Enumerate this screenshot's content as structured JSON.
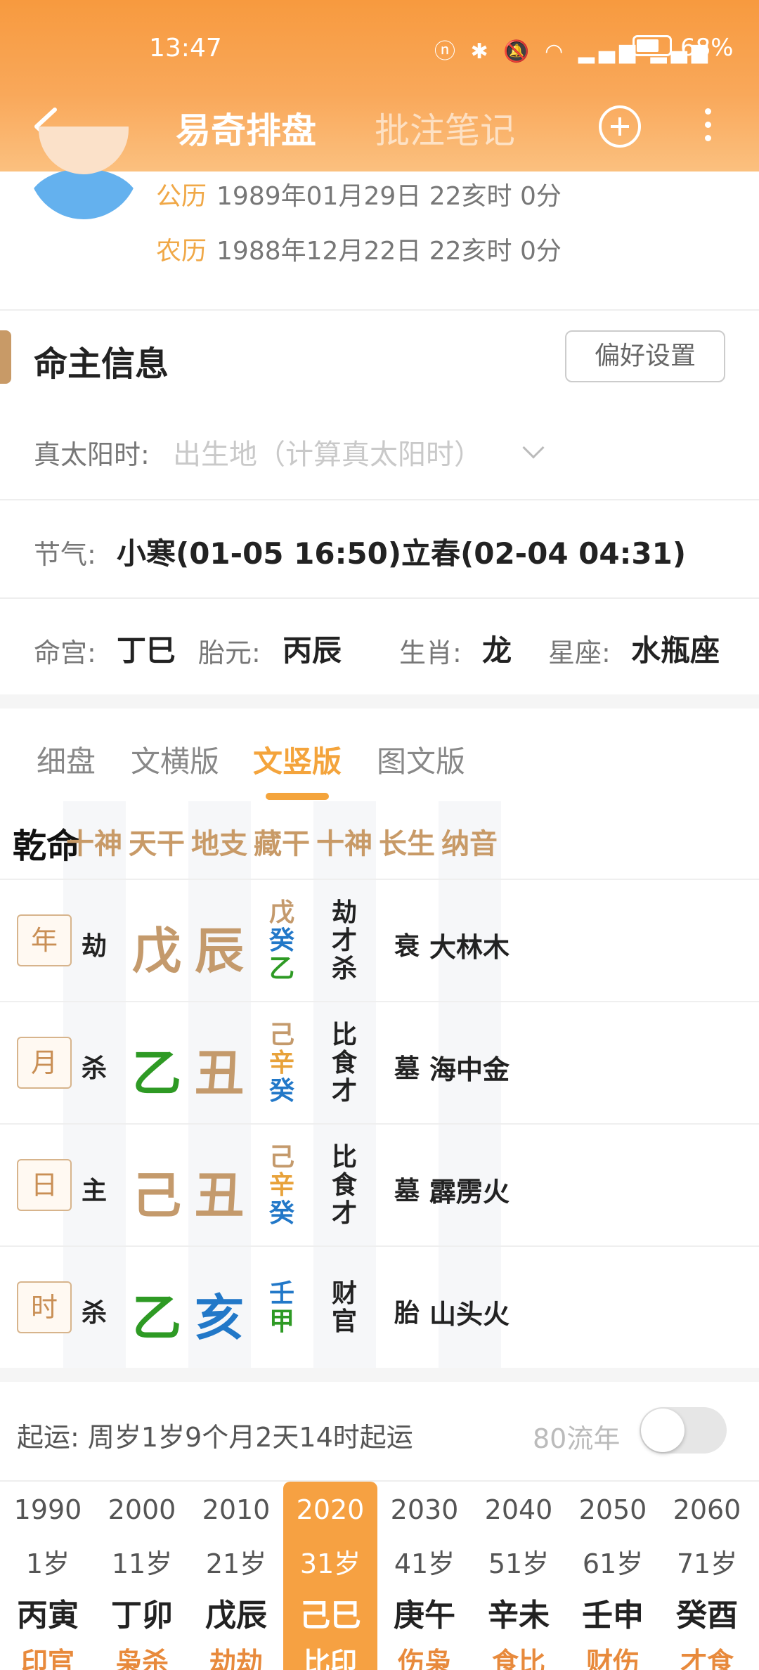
{
  "status_bar": {
    "time": "13:47",
    "battery": "68%",
    "battery_level": 0.68
  },
  "nav": {
    "title_active": "易奇排盘",
    "title_inactive": "批注笔记"
  },
  "birth": {
    "solar_label": "公历",
    "solar_value": "1989年01月29日 22亥时 0分",
    "lunar_label": "农历",
    "lunar_value": "1988年12月22日 22亥时 0分"
  },
  "section": {
    "title": "命主信息",
    "pref_button": "偏好设置"
  },
  "true_solar": {
    "label": "真太阳时:",
    "hint": "出生地（计算真太阳时）"
  },
  "jieqi": {
    "label": "节气:",
    "value": "小寒(01-05 16:50)立春(02-04 04:31)"
  },
  "info": {
    "minggong_label": "命宫:",
    "minggong": "丁巳",
    "taiyuan_label": "胎元:",
    "taiyuan": "丙辰",
    "shengxiao_label": "生肖:",
    "shengxiao": "龙",
    "xingzuo_label": "星座:",
    "xingzuo": "水瓶座"
  },
  "view_tabs": [
    "细盘",
    "文横版",
    "文竖版",
    "图文版"
  ],
  "table": {
    "title": "乾命",
    "headers": [
      "十神",
      "天干",
      "地支",
      "藏干",
      "十神",
      "长生",
      "纳音"
    ],
    "rows": [
      {
        "pillar": "年",
        "shishen": "劫",
        "gan": "戊",
        "zhi": "辰",
        "canggan": [
          "戊",
          "癸",
          "乙"
        ],
        "canggan_shishen": [
          "劫",
          "才",
          "杀"
        ],
        "changsheng": "衰",
        "nayin": "大林木"
      },
      {
        "pillar": "月",
        "shishen": "杀",
        "gan": "乙",
        "zhi": "丑",
        "canggan": [
          "己",
          "辛",
          "癸"
        ],
        "canggan_shishen": [
          "比",
          "食",
          "才"
        ],
        "changsheng": "墓",
        "nayin": "海中金"
      },
      {
        "pillar": "日",
        "shishen": "主",
        "gan": "己",
        "zhi": "丑",
        "canggan": [
          "己",
          "辛",
          "癸"
        ],
        "canggan_shishen": [
          "比",
          "食",
          "才"
        ],
        "changsheng": "墓",
        "nayin": "霹雳火"
      },
      {
        "pillar": "时",
        "shishen": "杀",
        "gan": "乙",
        "zhi": "亥",
        "canggan": [
          "壬",
          "甲"
        ],
        "canggan_shishen": [
          "财",
          "官"
        ],
        "changsheng": "胎",
        "nayin": "山头火"
      }
    ]
  },
  "colors": {
    "earth": "#c49a6c",
    "wood": "#2e9a24",
    "water": "#2278c8",
    "metal": "#e8a23a",
    "accent": "#f4a43c",
    "header": "#f79a3f"
  },
  "qiyun": {
    "text": "起运:  周岁1岁9个月2天14时起运",
    "flow_label": "80流年"
  },
  "dayun": [
    {
      "year": "1990",
      "age": "1岁",
      "ganzhi": "丙寅",
      "shishen": "印官"
    },
    {
      "year": "2000",
      "age": "11岁",
      "ganzhi": "丁卯",
      "shishen": "枭杀"
    },
    {
      "year": "2010",
      "age": "21岁",
      "ganzhi": "戊辰",
      "shishen": "劫劫"
    },
    {
      "year": "2020",
      "age": "31岁",
      "ganzhi": "己巳",
      "shishen": "比印",
      "active": true
    },
    {
      "year": "2030",
      "age": "41岁",
      "ganzhi": "庚午",
      "shishen": "伤枭"
    },
    {
      "year": "2040",
      "age": "51岁",
      "ganzhi": "辛未",
      "shishen": "食比"
    },
    {
      "year": "2050",
      "age": "61岁",
      "ganzhi": "壬申",
      "shishen": "财伤"
    },
    {
      "year": "2060",
      "age": "71岁",
      "ganzhi": "癸酉",
      "shishen": "才食"
    }
  ]
}
